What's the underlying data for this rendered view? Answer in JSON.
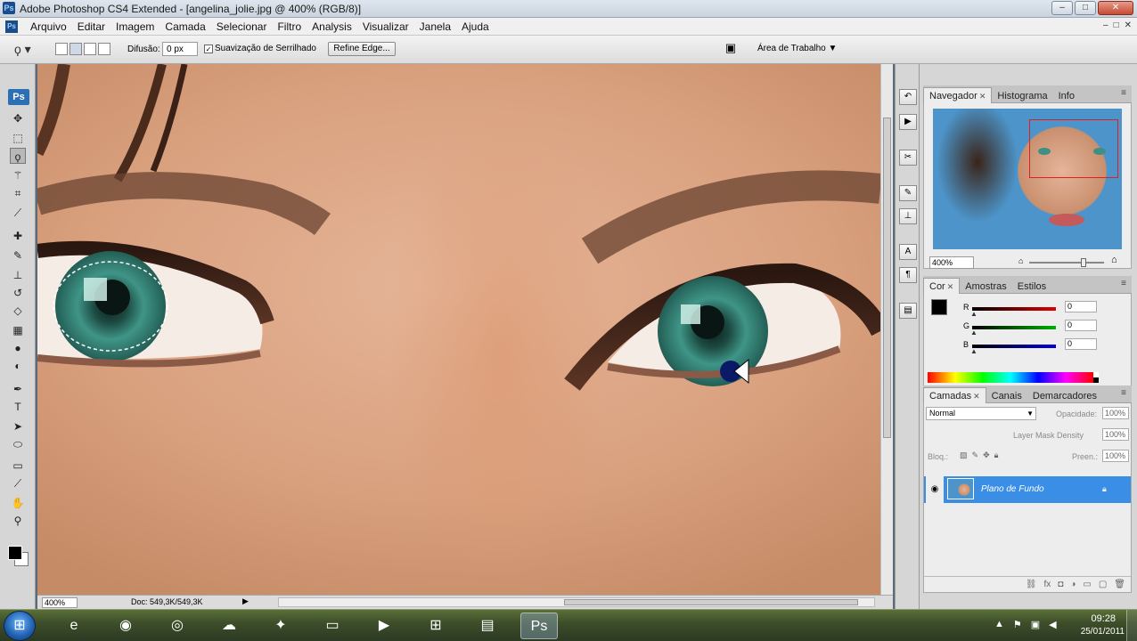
{
  "window": {
    "app_badge": "Ps",
    "title": "Adobe Photoshop CS4 Extended - [angelina_jolie.jpg @ 400% (RGB/8)]",
    "minimize": "–",
    "maximize": "□",
    "close": "✕"
  },
  "menubar": {
    "items": [
      "Arquivo",
      "Editar",
      "Imagem",
      "Camada",
      "Selecionar",
      "Filtro",
      "Analysis",
      "Visualizar",
      "Janela",
      "Ajuda"
    ],
    "doc_controls": [
      "–",
      "□",
      "✕"
    ]
  },
  "options": {
    "feather_label": "Difusão:",
    "feather_value": "0 px",
    "antialias_checked": "✓",
    "antialias_label": "Suavização de Serrilhado",
    "refine_edge": "Refine Edge...",
    "workspace_label": "Área de Trabalho ▼"
  },
  "tools": {
    "logo": "Ps",
    "items": [
      {
        "name": "move",
        "glyph": "✥"
      },
      {
        "name": "marquee",
        "glyph": "⬚"
      },
      {
        "name": "lasso",
        "glyph": "ϙ",
        "active": true
      },
      {
        "name": "magic-wand",
        "glyph": "⚚"
      },
      {
        "name": "crop",
        "glyph": "⌗"
      },
      {
        "name": "eyedropper",
        "glyph": "⟋"
      },
      {
        "name": "healing",
        "glyph": "✚"
      },
      {
        "name": "brush",
        "glyph": "✎"
      },
      {
        "name": "clone-stamp",
        "glyph": "⊥"
      },
      {
        "name": "history-brush",
        "glyph": "↺"
      },
      {
        "name": "eraser",
        "glyph": "◇"
      },
      {
        "name": "gradient",
        "glyph": "▦"
      },
      {
        "name": "blur",
        "glyph": "●"
      },
      {
        "name": "dodge",
        "glyph": "◐"
      },
      {
        "name": "pen",
        "glyph": "✒"
      },
      {
        "name": "type",
        "glyph": "T"
      },
      {
        "name": "path-selection",
        "glyph": "➤"
      },
      {
        "name": "shape",
        "glyph": "⬭"
      },
      {
        "name": "notes",
        "glyph": "▭"
      },
      {
        "name": "eyedropper-3d",
        "glyph": "⟋"
      },
      {
        "name": "hand",
        "glyph": "✋"
      },
      {
        "name": "zoom",
        "glyph": "⚲"
      }
    ]
  },
  "status": {
    "zoom": "400%",
    "doc": "Doc: 549,3K/549,3K",
    "arrow": "▶"
  },
  "navigator": {
    "tabs": [
      "Navegador",
      "Histograma",
      "Info"
    ],
    "zoom": "400%",
    "small_mountain": "⌂",
    "big_mountain": "⌂"
  },
  "color": {
    "tabs": [
      "Cor",
      "Amostras",
      "Estilos"
    ],
    "channels": [
      {
        "label": "R",
        "value": "0",
        "color": "#e00000"
      },
      {
        "label": "G",
        "value": "0",
        "color": "#00b000"
      },
      {
        "label": "B",
        "value": "0",
        "color": "#0000e0"
      }
    ]
  },
  "layers": {
    "tabs": [
      "Camadas",
      "Canais",
      "Demarcadores"
    ],
    "blend_mode": "Normal",
    "opacity_label": "Opacidade:",
    "opacity_value": "100%",
    "mask_density_label": "Layer Mask Density",
    "mask_density_value": "100%",
    "lock_label": "Bloq.:",
    "fill_label": "Preen.:",
    "fill_value": "100%",
    "layer_name": "Plano de Fundo"
  },
  "taskbar": {
    "time": "09:28",
    "date": "25/01/2011"
  }
}
